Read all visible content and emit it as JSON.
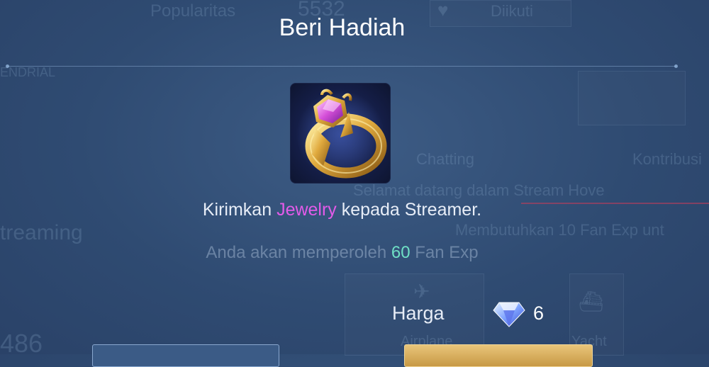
{
  "background": {
    "popularity_label": "Popularitas",
    "popularity_value": "5532",
    "follow_label": "Diikuti",
    "left_tab": "ENDRIAL",
    "tab_chatting": "Chatting",
    "tab_contribution": "Kontribusi",
    "welcome": "Selamat datang dalam Stream Hove",
    "streaming_label": "treaming",
    "fan_requirement": "Membutuhkan 10 Fan Exp unt",
    "count_value": "486",
    "gift_airplane": "Airplane",
    "gift_yacht": "Yacht"
  },
  "dialog": {
    "title": "Beri Hadiah",
    "gift_icon": "jewelry-ring-icon",
    "message_prefix": "Kirimkan ",
    "gift_name": "Jewelry",
    "message_suffix": " kepada Streamer.",
    "fan_exp_prefix": "Anda akan memperoleh ",
    "fan_exp_value": "60",
    "fan_exp_suffix": " Fan Exp",
    "price_label": "Harga",
    "price_icon": "diamond-icon",
    "price_value": "6"
  },
  "colors": {
    "highlight_gift": "#e35be9",
    "highlight_exp": "#6fe0c5",
    "confirm_button": "#d8b05c"
  }
}
